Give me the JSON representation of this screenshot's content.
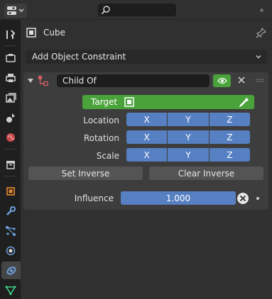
{
  "header": {
    "editor_type_icon": "properties-editor-icon",
    "search": {
      "value": "",
      "placeholder": ""
    }
  },
  "sidebar": {
    "tabs": [
      {
        "name": "tool",
        "icon": "wrench-screwdriver-icon",
        "active": false
      },
      {
        "name": "render",
        "icon": "camera-back-icon",
        "active": false
      },
      {
        "name": "output",
        "icon": "printer-icon",
        "active": false
      },
      {
        "name": "view-layer",
        "icon": "image-stack-icon",
        "active": false
      },
      {
        "name": "scene",
        "icon": "scene-icon",
        "active": false
      },
      {
        "name": "world",
        "icon": "world-icon",
        "active": false
      },
      {
        "name": "collection",
        "icon": "collection-box-icon",
        "active": false
      },
      {
        "name": "object",
        "icon": "object-square-icon",
        "active": false
      },
      {
        "name": "modifiers",
        "icon": "wrench-icon",
        "active": false
      },
      {
        "name": "particles",
        "icon": "particles-icon",
        "active": false
      },
      {
        "name": "physics",
        "icon": "physics-orbit-icon",
        "active": false
      },
      {
        "name": "object-constraint",
        "icon": "constraint-icon",
        "active": true
      },
      {
        "name": "object-data",
        "icon": "mesh-triangle-icon",
        "active": false
      }
    ]
  },
  "object": {
    "name": "Cube"
  },
  "add_constraint": {
    "label": "Add Object Constraint"
  },
  "constraint": {
    "name": "Child Of",
    "target_label": "Target",
    "target_value": "",
    "rows": [
      {
        "label": "Location",
        "axes": [
          "X",
          "Y",
          "Z"
        ]
      },
      {
        "label": "Rotation",
        "axes": [
          "X",
          "Y",
          "Z"
        ]
      },
      {
        "label": "Scale",
        "axes": [
          "X",
          "Y",
          "Z"
        ]
      }
    ],
    "set_inverse": "Set Inverse",
    "clear_inverse": "Clear Inverse",
    "influence_label": "Influence",
    "influence_value": "1.000",
    "influence_fraction": 1.0
  },
  "colors": {
    "accent_blue": "#5680c2",
    "accent_green": "#4aa23a",
    "panel_bg": "#3d3d3d",
    "window_bg": "#303030"
  }
}
